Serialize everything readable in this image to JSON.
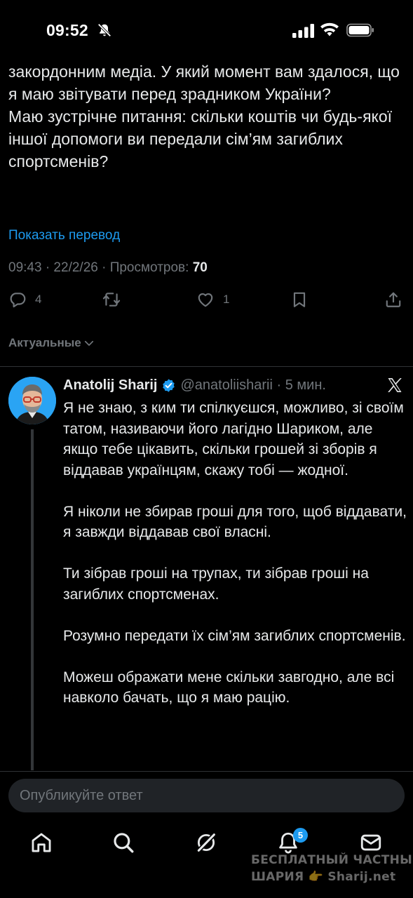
{
  "status_bar": {
    "time": "09:52",
    "icons": [
      "bell-muted-icon",
      "cellular-signal-icon",
      "wifi-icon",
      "battery-icon"
    ]
  },
  "tweet": {
    "paragraphs": [
      "закордонним медіа. У який момент вам здалося, що я маю звітувати перед зрадником України?",
      "Маю зустрічне питання: скільки коштів чи будь-якої іншої допомоги ви передали сім’ям загиблих спортсменів?"
    ],
    "translate_link": "Показать перевод",
    "meta_prefix": "09:43 · 22/2/26 · Просмотров: ",
    "views": "70",
    "actions": {
      "replies": "4",
      "likes": "1"
    }
  },
  "sort": {
    "label": "Актуальные"
  },
  "reply": {
    "name": "Anatolij Sharij",
    "handle_time": "@anatoliisharii · 5 мин.",
    "paragraphs": [
      "Я не знаю, з ким ти спілкуєшся, можливо, зі своїм татом, називаючи його лагідно Шариком, але якщо тебе цікавить, скільки грошей зі зборів я віддавав українцям, скажу тобі — жодної.",
      "Я ніколи не збирав гроші для того, щоб віддавати, я завжди віддавав свої власні.",
      "Ти зібрав гроші на трупах, ти зібрав гроші на загиблих спортсменах.",
      "Розумно передати їх сім’ям загиблих спортсменів.",
      "Можеш ображати мене скільки завгодно, але всі навколо бачать, що я маю рацію."
    ]
  },
  "compose": {
    "placeholder": "Опубликуйте ответ"
  },
  "tabbar": {
    "notifications_badge": "5",
    "icons": [
      "home-icon",
      "search-icon",
      "grok-icon",
      "notifications-icon",
      "messages-icon"
    ]
  },
  "watermark": {
    "line1": "БЕСПЛАТНЫЙ ЧАСТНЫЙ",
    "line2": "ШАРИЯ 👉 Sharij.net"
  },
  "colors": {
    "background": "#000000",
    "text": "#e7e9ea",
    "muted": "#71767b",
    "accent": "#1d9bf0"
  }
}
